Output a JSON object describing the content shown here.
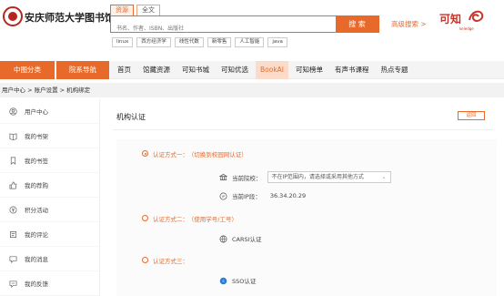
{
  "header": {
    "library_name": "安庆师范大学图书馆",
    "search_tabs": [
      "资源",
      "全文"
    ],
    "search_placeholder": "书名、作者、ISBN、出版社",
    "search_button": "搜 索",
    "advanced_search": "高级搜索 >",
    "keywords": [
      "linux",
      "西方经济学",
      "线性代数",
      "新零售",
      "人工智能",
      "java"
    ],
    "brand": "可知",
    "brand_sub": "keledge"
  },
  "nav": {
    "btn_category": "中图分类",
    "btn_department": "院系导航",
    "items": [
      "首页",
      "馆藏资源",
      "可知书城",
      "可知优选",
      "BookAI",
      "可知榜单",
      "有声书课程",
      "热点专题"
    ]
  },
  "breadcrumb": "用户中心 > 账户设置 > 机构绑定",
  "sidebar": {
    "items": [
      {
        "label": "用户中心",
        "icon": "user-icon"
      },
      {
        "label": "我的书架",
        "icon": "book-icon"
      },
      {
        "label": "我的书签",
        "icon": "bookmark-icon"
      },
      {
        "label": "我的荐购",
        "icon": "thumb-icon"
      },
      {
        "label": "积分活动",
        "icon": "coin-icon"
      },
      {
        "label": "我的评论",
        "icon": "comment-icon"
      },
      {
        "label": "我的消息",
        "icon": "message-icon"
      },
      {
        "label": "我的反馈",
        "icon": "feedback-icon"
      }
    ]
  },
  "main": {
    "title": "机构认证",
    "back_button": "返回",
    "method1": {
      "label": "认证方式一：",
      "desc": "（切换到校园网认证）"
    },
    "current_school_label": "当前院校：",
    "current_school_value": "不在IP范围内，请选择或采用其他方式",
    "current_ip_label": "当前IP段：",
    "current_ip_value": "36.34.20.29",
    "method2": {
      "label": "认证方式二：",
      "desc": "（使用学号/工号）"
    },
    "carsi_label": "CARSI认证",
    "method3": {
      "label": "认证方式三："
    },
    "sso_label": "SSO认证"
  },
  "colors": {
    "accent": "#e86a2a",
    "brand": "#c7342c"
  }
}
